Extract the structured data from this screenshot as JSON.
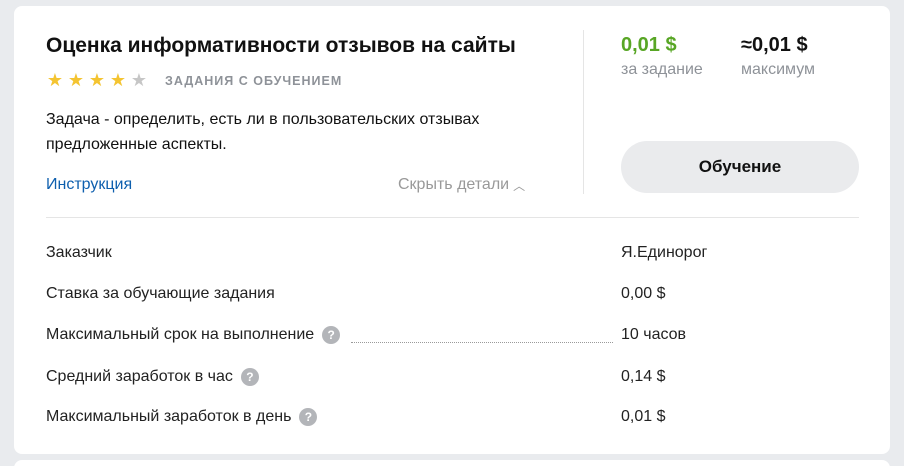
{
  "task": {
    "title": "Оценка информативности отзывов на сайты",
    "rating": {
      "filled": 4,
      "total": 5
    },
    "badge": "ЗАДАНИЯ С ОБУЧЕНИЕМ",
    "description": "Задача - определить, есть ли в пользовательских отзывах предложенные аспекты.",
    "instruction_link": "Инструкция",
    "hide_details": "Скрыть детали",
    "price_per_task": {
      "value": "0,01",
      "currency": "$",
      "caption": "за задание"
    },
    "price_max": {
      "prefix": "≈",
      "value": "0,01",
      "currency": "$",
      "caption": "максимум"
    },
    "train_button": "Обучение"
  },
  "details": [
    {
      "label": "Заказчик",
      "value": "Я.Единорог",
      "help": false
    },
    {
      "label": "Ставка за обучающие задания",
      "value": "0,00 $",
      "help": false
    },
    {
      "label": "Максимальный срок на выполнение",
      "value": "10 часов",
      "help": true
    },
    {
      "label": "Средний заработок в час",
      "value": "0,14 $",
      "help": true
    },
    {
      "label": "Максимальный заработок в день",
      "value": "0,01 $",
      "help": true
    }
  ],
  "colors": {
    "accent_green": "#58a625",
    "link_blue": "#0e5fae",
    "star": "#f4c431"
  },
  "icons": {
    "help": "question-icon",
    "chevron": "chevron-up-icon",
    "star": "star-icon"
  }
}
